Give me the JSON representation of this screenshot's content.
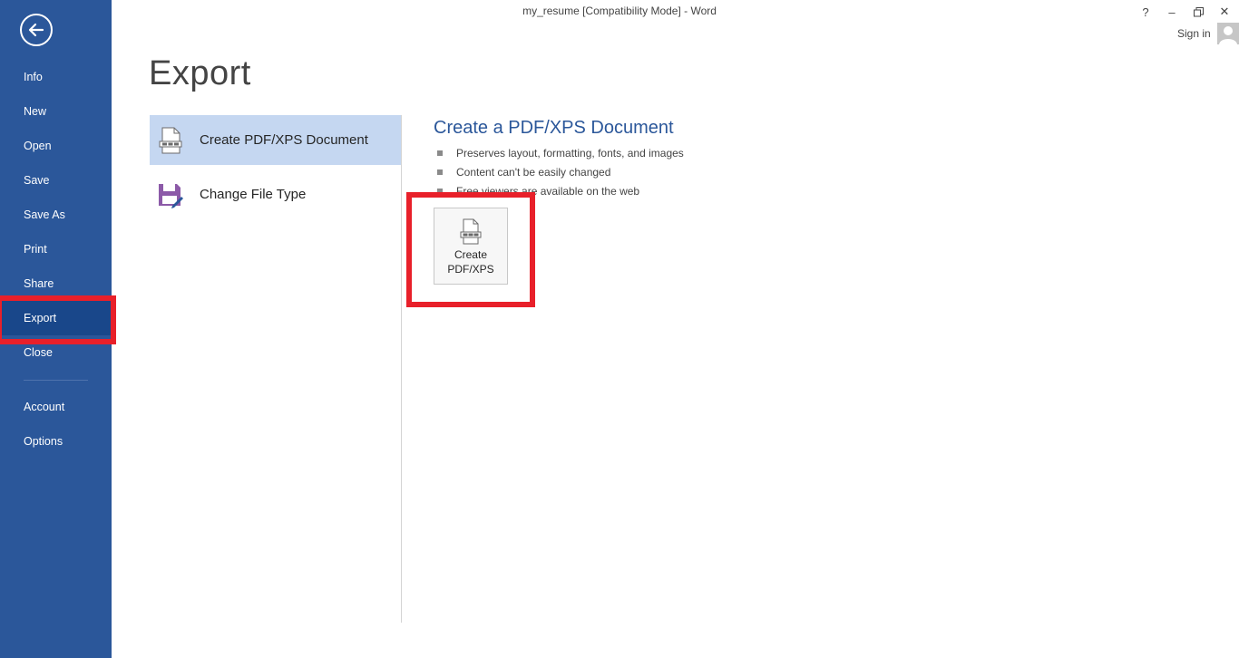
{
  "window": {
    "title": "my_resume [Compatibility Mode] - Word",
    "help": "?",
    "minimize": "–",
    "restore": "🗗",
    "close": "✕",
    "sign_in": "Sign in"
  },
  "sidebar": {
    "items": [
      {
        "label": "Info"
      },
      {
        "label": "New"
      },
      {
        "label": "Open"
      },
      {
        "label": "Save"
      },
      {
        "label": "Save As"
      },
      {
        "label": "Print"
      },
      {
        "label": "Share"
      },
      {
        "label": "Export",
        "active": true
      },
      {
        "label": "Close"
      },
      {
        "label": "Account"
      },
      {
        "label": "Options"
      }
    ]
  },
  "main": {
    "title": "Export",
    "options": [
      {
        "label": "Create PDF/XPS Document",
        "icon": "pdf-document-icon",
        "selected": true
      },
      {
        "label": "Change File Type",
        "icon": "save-file-type-icon",
        "selected": false
      }
    ],
    "detail": {
      "title": "Create a PDF/XPS Document",
      "bullets": [
        "Preserves layout, formatting, fonts, and images",
        "Content can't be easily changed",
        "Free viewers are available on the web"
      ],
      "button_line1": "Create",
      "button_line2": "PDF/XPS"
    }
  },
  "colors": {
    "sidebar": "#2b579a",
    "sidebar_active": "#19478a",
    "selected_option": "#c5d7f1",
    "highlight": "#e8202a",
    "accent_text": "#2b579a"
  }
}
